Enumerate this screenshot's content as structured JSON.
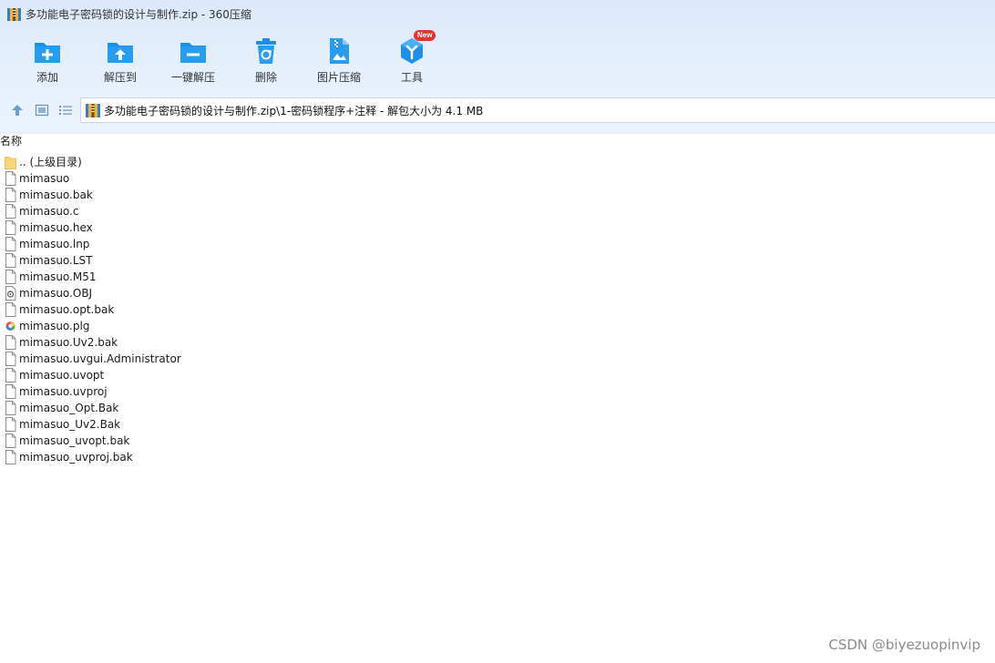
{
  "window": {
    "title": "多功能电子密码锁的设计与制作.zip - 360压缩"
  },
  "toolbar": {
    "buttons": [
      {
        "label": "添加",
        "icon": "add-icon"
      },
      {
        "label": "解压到",
        "icon": "extract-to-icon"
      },
      {
        "label": "一键解压",
        "icon": "one-click-extract-icon"
      },
      {
        "label": "删除",
        "icon": "delete-icon"
      },
      {
        "label": "图片压缩",
        "icon": "image-compress-icon"
      },
      {
        "label": "工具",
        "icon": "tools-icon",
        "badge": "New"
      }
    ],
    "accent_color": "#1e8fe8",
    "badge_color": "#e8322f"
  },
  "nav": {
    "address": "多功能电子密码锁的设计与制作.zip\\1-密码锁程序+注释 - 解包大小为 4.1 MB"
  },
  "file_list": {
    "column_header": "名称",
    "items": [
      {
        "name": ".. (上级目录)",
        "icon": "folder-icon"
      },
      {
        "name": "mimasuo",
        "icon": "file-icon"
      },
      {
        "name": "mimasuo.bak",
        "icon": "file-icon"
      },
      {
        "name": "mimasuo.c",
        "icon": "file-icon"
      },
      {
        "name": "mimasuo.hex",
        "icon": "file-icon"
      },
      {
        "name": "mimasuo.lnp",
        "icon": "file-icon"
      },
      {
        "name": "mimasuo.LST",
        "icon": "file-icon"
      },
      {
        "name": "mimasuo.M51",
        "icon": "file-icon"
      },
      {
        "name": "mimasuo.OBJ",
        "icon": "obj-file-icon"
      },
      {
        "name": "mimasuo.opt.bak",
        "icon": "file-icon"
      },
      {
        "name": "mimasuo.plg",
        "icon": "plg-file-icon"
      },
      {
        "name": "mimasuo.Uv2.bak",
        "icon": "file-icon"
      },
      {
        "name": "mimasuo.uvgui.Administrator",
        "icon": "file-icon"
      },
      {
        "name": "mimasuo.uvopt",
        "icon": "file-icon"
      },
      {
        "name": "mimasuo.uvproj",
        "icon": "file-icon"
      },
      {
        "name": "mimasuo_Opt.Bak",
        "icon": "file-icon"
      },
      {
        "name": "mimasuo_Uv2.Bak",
        "icon": "file-icon"
      },
      {
        "name": "mimasuo_uvopt.bak",
        "icon": "file-icon"
      },
      {
        "name": "mimasuo_uvproj.bak",
        "icon": "file-icon"
      }
    ]
  },
  "watermark": "CSDN @biyezuopinvip"
}
